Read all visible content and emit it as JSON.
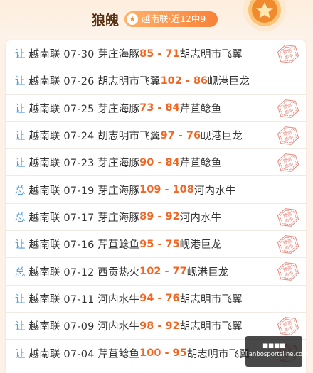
{
  "header": {
    "title": "狼魄",
    "badge": "越南联·近12中9",
    "medal_icon": "medal-star-icon"
  },
  "accent": "#f26522",
  "tag_color": "#5b9bd5",
  "stamp_text": "预测命中",
  "rows": [
    {
      "tag": "让",
      "text": "越南联 07-30 芽庄海豚",
      "score": "85 - 71",
      "away": "胡志明市飞翼",
      "hit": true
    },
    {
      "tag": "让",
      "text": "越南联 07-26 胡志明市飞翼",
      "score": "102 - 86",
      "away": "岘港巨龙",
      "hit": false
    },
    {
      "tag": "让",
      "text": "越南联 07-25 芽庄海豚",
      "score": "73 - 84",
      "away": "芹苴鲶鱼",
      "hit": true
    },
    {
      "tag": "让",
      "text": "越南联 07-24 胡志明市飞翼",
      "score": "97 - 76",
      "away": "岘港巨龙",
      "hit": true
    },
    {
      "tag": "让",
      "text": "越南联 07-23 芽庄海豚",
      "score": "90 - 84",
      "away": "芹苴鲶鱼",
      "hit": true
    },
    {
      "tag": "总",
      "text": "越南联 07-19 芽庄海豚",
      "score": "109 - 108",
      "away": "河内水牛",
      "hit": false
    },
    {
      "tag": "总",
      "text": "越南联 07-17 芽庄海豚",
      "score": "89 - 92",
      "away": "河内水牛",
      "hit": true
    },
    {
      "tag": "让",
      "text": "越南联 07-16 芹苴鲶鱼",
      "score": "95 - 75",
      "away": "岘港巨龙",
      "hit": true
    },
    {
      "tag": "总",
      "text": "越南联 07-12 西贡热火",
      "score": "102 - 77",
      "away": "岘港巨龙",
      "hit": true
    },
    {
      "tag": "让",
      "text": "越南联 07-11 河内水牛",
      "score": "94 - 76",
      "away": "胡志明市飞翼",
      "hit": false
    },
    {
      "tag": "让",
      "text": "越南联 07-09 河内水牛",
      "score": "98 - 92",
      "away": "胡志明市飞翼",
      "hit": true
    },
    {
      "tag": "让",
      "text": "越南联 07-04 芹苴鲶鱼",
      "score": "100 - 95",
      "away": "胡志明市飞翼",
      "hit": true
    }
  ],
  "watermark": {
    "line1": "■■■■",
    "line2": "lianbosportsline.com"
  }
}
